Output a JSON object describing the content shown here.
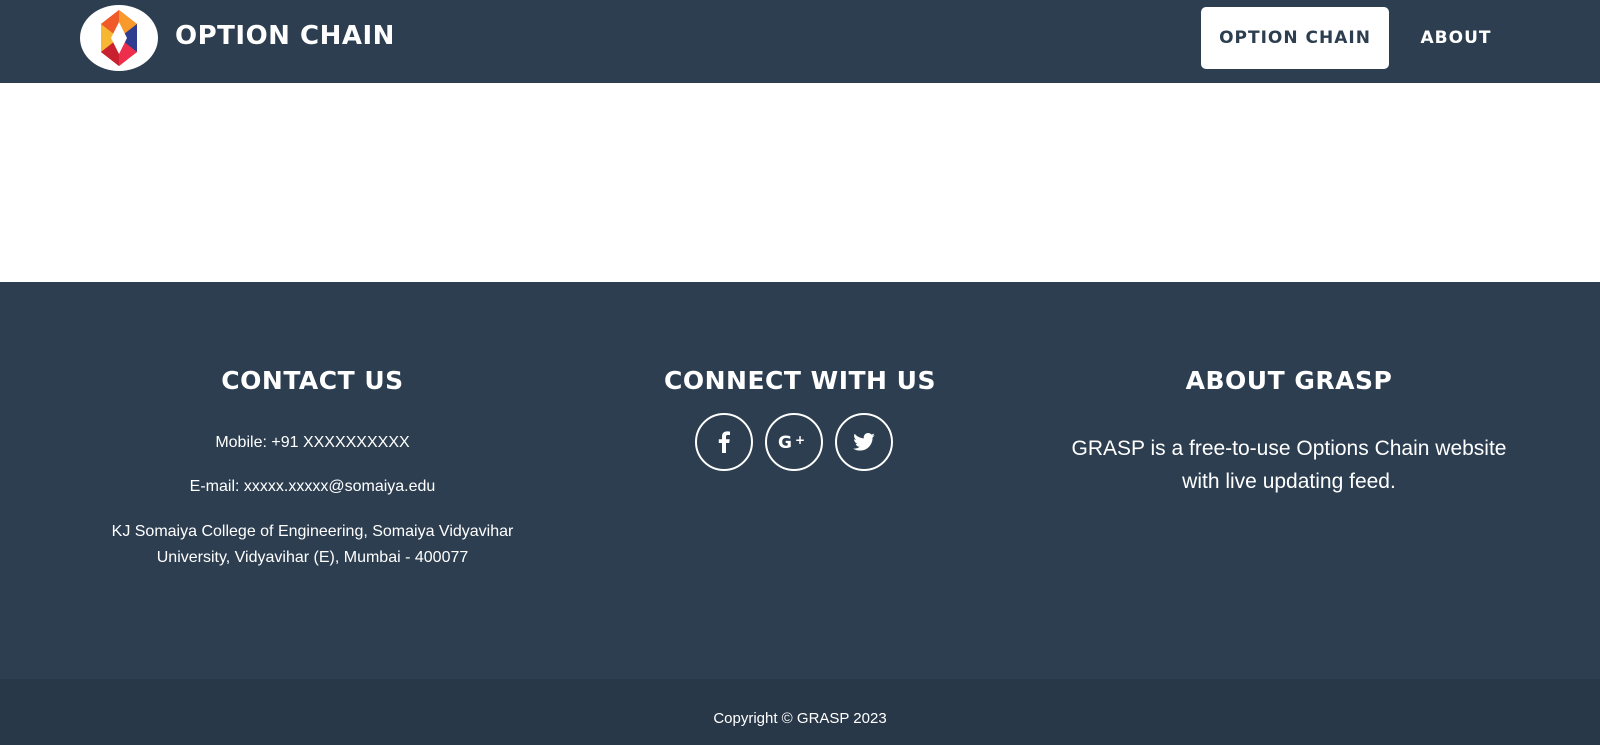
{
  "navbar": {
    "brand": "OPTION CHAIN",
    "logo_icon": "grasp-hexagon-logo",
    "items": [
      {
        "label": "OPTION CHAIN",
        "active": true
      },
      {
        "label": "ABOUT",
        "active": false
      }
    ]
  },
  "footer": {
    "contact": {
      "heading": "CONTACT US",
      "mobile": "Mobile: +91 XXXXXXXXXX",
      "email": "E-mail: xxxxx.xxxxx@somaiya.edu",
      "address": "KJ Somaiya College of Engineering, Somaiya Vidyavihar University,  Vidyavihar (E), Mumbai - 400077"
    },
    "connect": {
      "heading": "CONNECT WITH US",
      "icons": [
        "facebook-icon",
        "google-plus-icon",
        "twitter-icon"
      ]
    },
    "about": {
      "heading": "ABOUT GRASP",
      "text": "GRASP is a free-to-use Options Chain website with live updating feed."
    },
    "copyright": "Copyright © GRASP 2023"
  },
  "colors": {
    "primary": "#2c3e50",
    "copyright_bar": "#283848",
    "text": "#ffffff"
  }
}
